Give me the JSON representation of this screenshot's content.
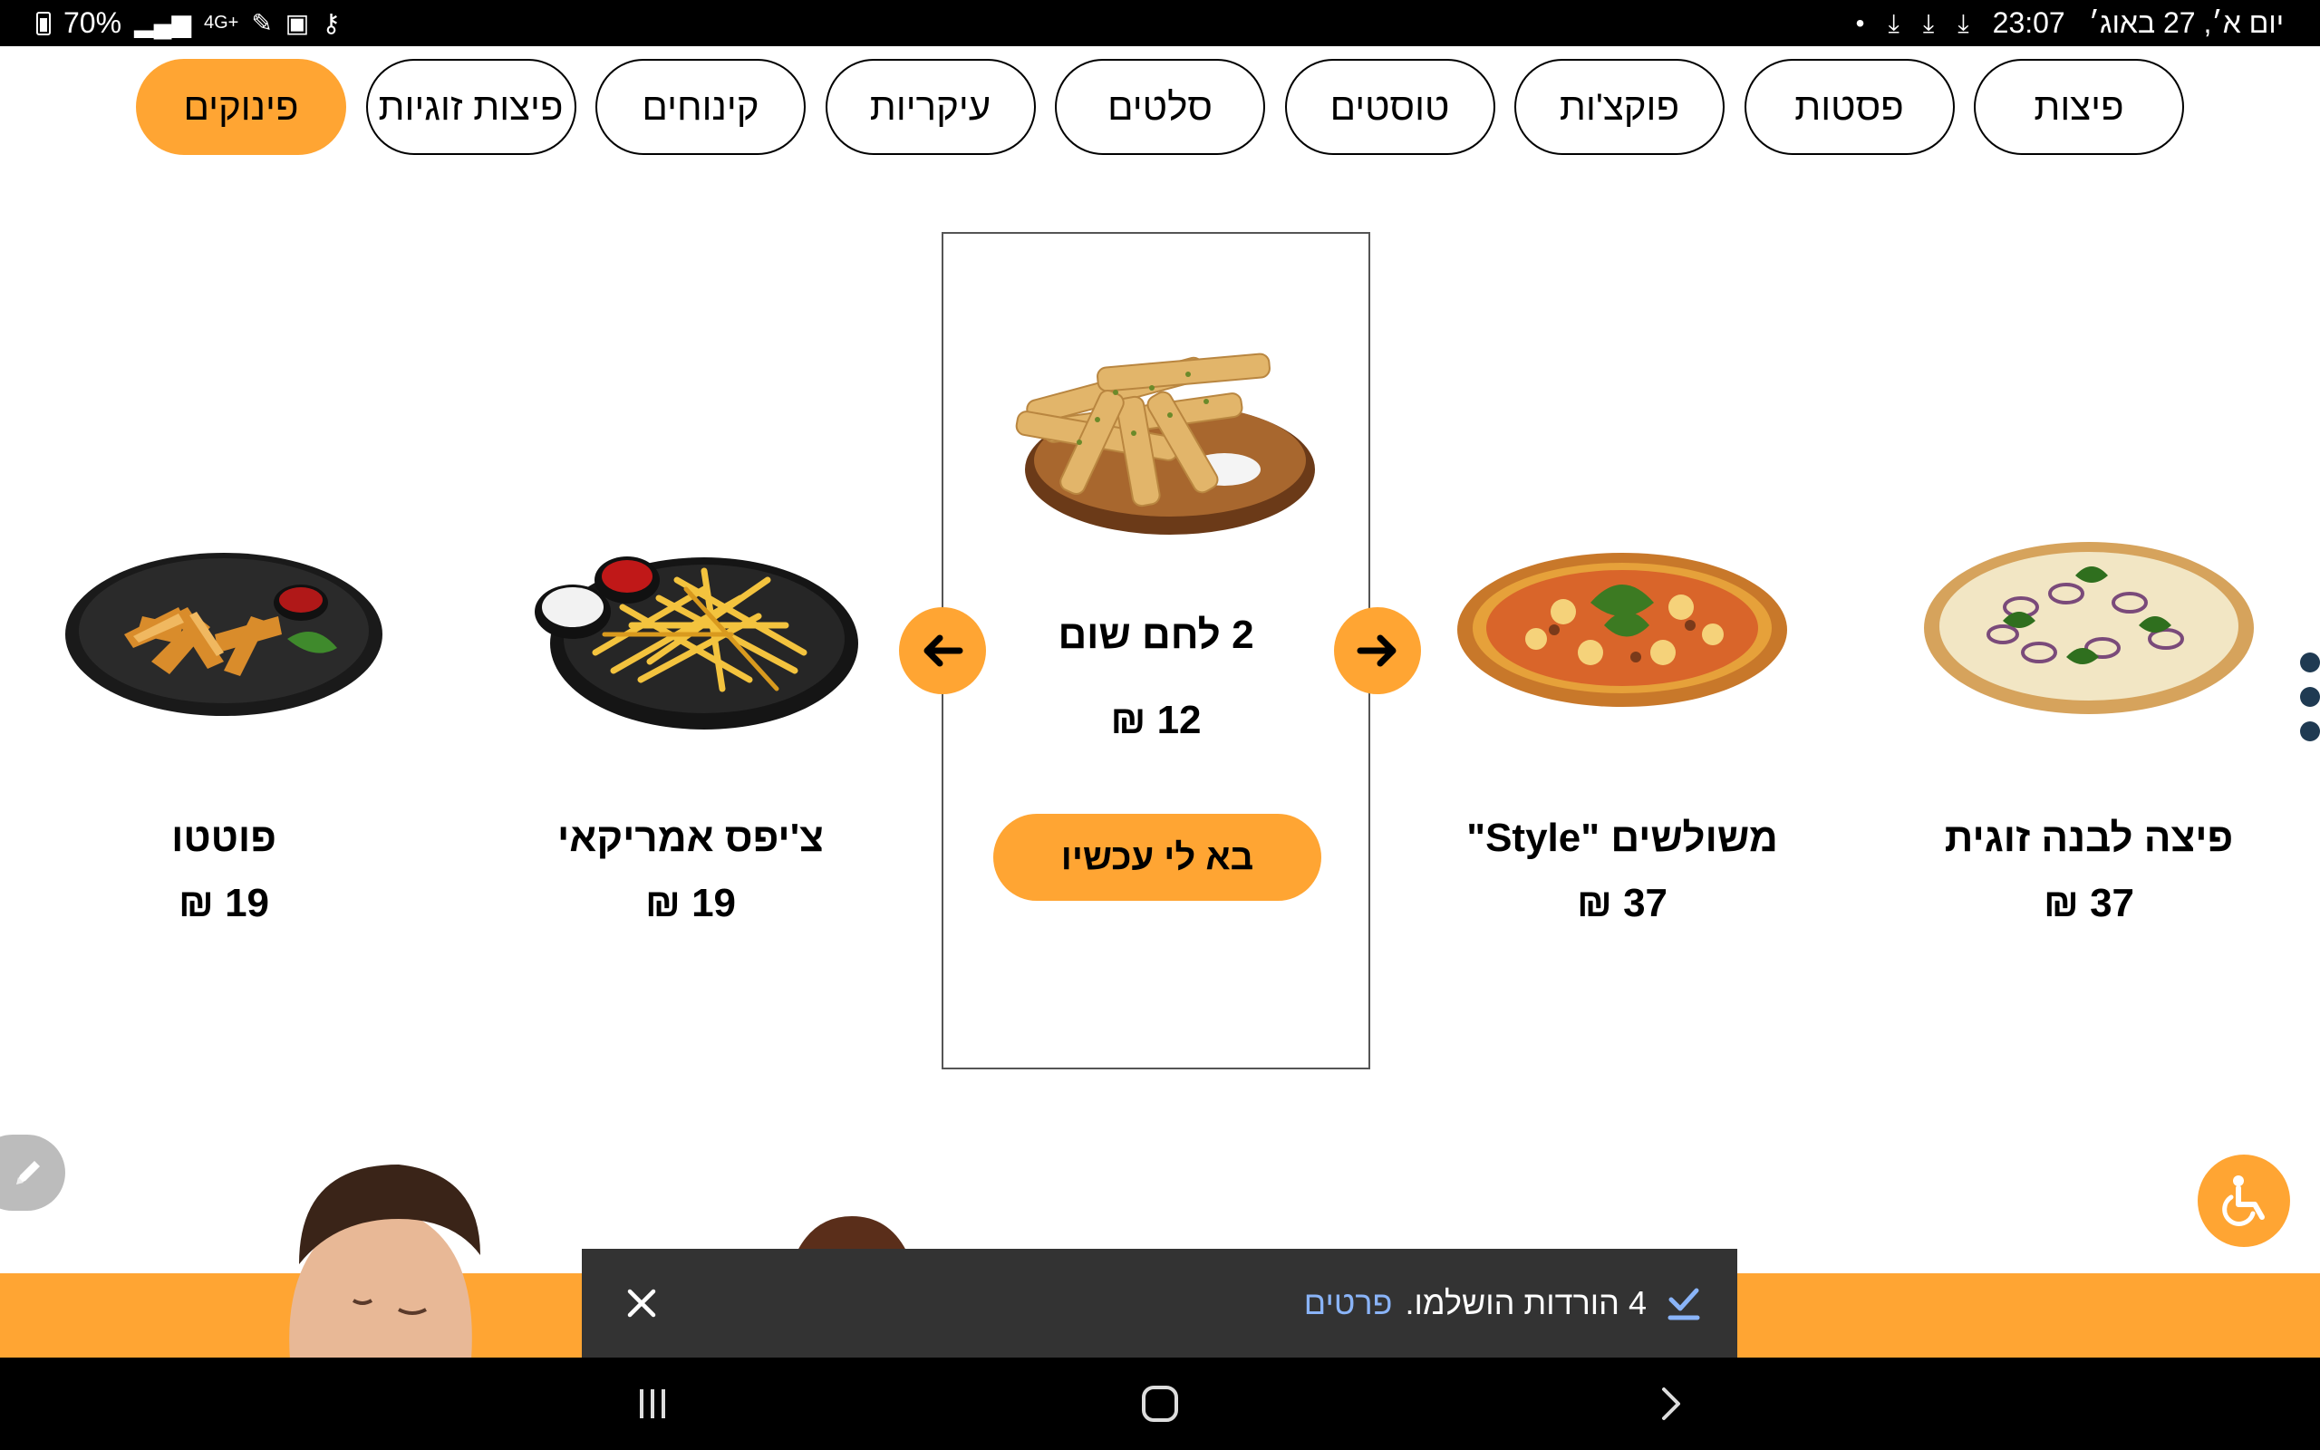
{
  "status_bar": {
    "battery": "70%",
    "network": "4G+",
    "time": "23:07",
    "date": "יום א׳, 27 באוג׳"
  },
  "categories": [
    {
      "label": "פיצות",
      "active": false
    },
    {
      "label": "פסטות",
      "active": false
    },
    {
      "label": "פוקצ'ות",
      "active": false
    },
    {
      "label": "טוסטים",
      "active": false
    },
    {
      "label": "סלטים",
      "active": false
    },
    {
      "label": "עיקריות",
      "active": false
    },
    {
      "label": "קינוחים",
      "active": false
    },
    {
      "label": "פיצות זוגיות",
      "active": false
    },
    {
      "label": "פינוקים",
      "active": true
    }
  ],
  "products": {
    "potato": {
      "name": "פוטטו",
      "price": "19 ₪"
    },
    "fries": {
      "name": "צ'יפס אמריקאי",
      "price": "19 ₪"
    },
    "garlic_bread": {
      "name": "2 לחם שום",
      "price": "12 ₪",
      "cta": "בא לי עכשיו"
    },
    "triangles": {
      "name": "משולשים \"Style\"",
      "price": "37 ₪"
    },
    "white_pizza": {
      "name": "פיצה לבנה זוגית",
      "price": "37 ₪"
    }
  },
  "snackbar": {
    "message": "4 הורדות הושלמו.",
    "link": "פרטים"
  },
  "colors": {
    "accent": "#ffa533",
    "snackbar_bg": "#333333",
    "link": "#8ab4f8"
  },
  "icons": [
    "arrow-left-icon",
    "arrow-right-icon",
    "pencil-icon",
    "wheelchair-icon",
    "close-icon",
    "check-icon",
    "recent-apps-icon",
    "home-icon",
    "back-icon"
  ]
}
